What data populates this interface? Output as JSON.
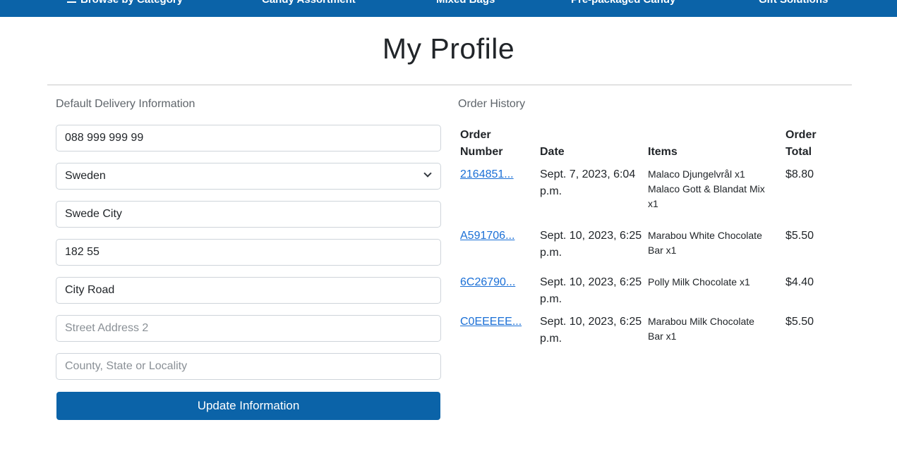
{
  "nav": {
    "items": [
      "Browse by Category",
      "Candy Assortment",
      "Mixed Bags",
      "Pre-packaged Candy",
      "Gift Solutions"
    ]
  },
  "page_title": "My Profile",
  "delivery": {
    "heading": "Default Delivery Information",
    "phone": "088 999 999 99",
    "country": "Sweden",
    "city": "Swede City",
    "postcode": "182 55",
    "street1": "City Road",
    "street2_placeholder": "Street Address 2",
    "county_placeholder": "County, State or Locality",
    "update_label": "Update Information"
  },
  "orders": {
    "heading": "Order History",
    "columns": {
      "number": [
        "Order",
        "Number"
      ],
      "date": "Date",
      "items": "Items",
      "total": [
        "Order",
        "Total"
      ]
    },
    "rows": [
      {
        "number": "2164851...",
        "date": [
          "Sept. 7, 2023, 6:04",
          "p.m."
        ],
        "items": [
          "Malaco Djungelvrål x1",
          "Malaco Gott & Blandat Mix",
          "x1"
        ],
        "total": "$8.80"
      },
      {
        "number": "A591706...",
        "date": [
          "Sept. 10, 2023, 6:25",
          "p.m."
        ],
        "items": [
          "Marabou White Chocolate",
          "Bar x1"
        ],
        "total": "$5.50"
      },
      {
        "number": "6C26790...",
        "date": [
          "Sept. 10, 2023, 6:25",
          "p.m."
        ],
        "items": [
          "Polly Milk Chocolate x1"
        ],
        "total": "$4.40"
      },
      {
        "number": "C0EEEEE...",
        "date": [
          "Sept. 10, 2023, 6:25",
          "p.m."
        ],
        "items": [
          "Marabou Milk Chocolate",
          "Bar x1"
        ],
        "total": "$5.50"
      }
    ]
  },
  "colors": {
    "brand_blue": "#0b63a8",
    "link_blue": "#1a6fd6"
  },
  "icons": {
    "menu": "menu-icon",
    "select_arrow": "chevron-down-icon"
  }
}
